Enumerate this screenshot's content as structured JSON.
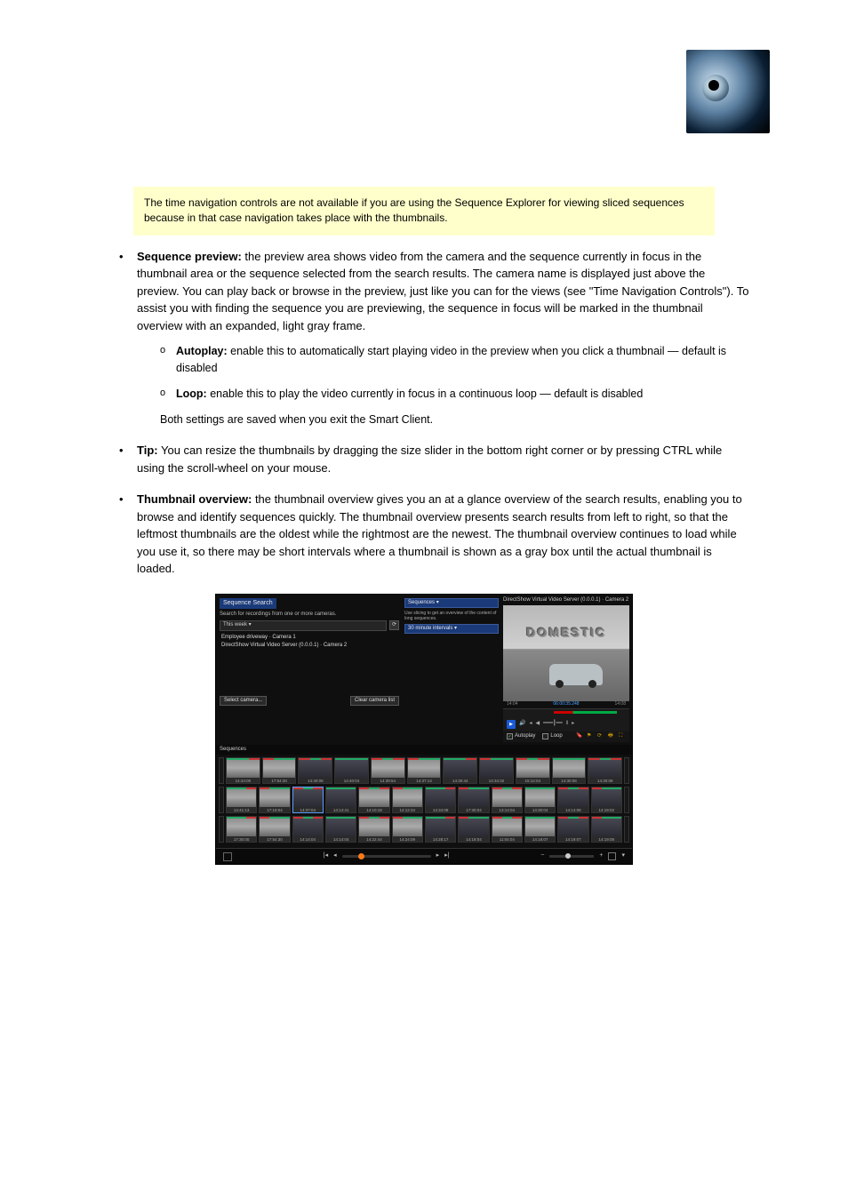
{
  "note": "The time navigation controls are not available if you are using the Sequence Explorer for viewing sliced sequences because in that case navigation takes place with the thumbnails.",
  "bullets": {
    "seq_preview": {
      "heading": "Sequence preview:",
      "text": " the preview area shows video from the camera and the sequence currently in focus in the thumbnail area or the sequence selected from the search results. The camera name is displayed just above the preview. You can play back or browse in the preview, just like you can for the views (see \"Time Navigation Controls\"). To assist you with finding the sequence you are previewing, the sequence in focus will be marked in the thumbnail overview with an expanded, light gray frame.",
      "sub": {
        "autoplay": {
          "heading": "Autoplay:",
          "text": " enable this to automatically start playing video in the preview when you click a thumbnail — default is disabled"
        },
        "loop": {
          "heading": "Loop:",
          "text": " enable this to play the video currently in focus in a continuous loop — default is disabled"
        },
        "hint": "Both settings are saved when you exit the Smart Client."
      }
    },
    "tip": {
      "label": "Tip:",
      "text": " You can resize the thumbnails by dragging the size slider in the bottom right corner or by pressing CTRL while using the scroll-wheel on your mouse."
    },
    "thumb_overview": {
      "heading": "Thumbnail overview:",
      "text": " the thumbnail overview gives you an at a glance overview of the search results, enabling you to browse and identify sequences quickly. The thumbnail overview presents search results from left to right, so that the leftmost thumbnails are the oldest while the rightmost are the newest. The thumbnail overview continues to load while you use it, so there may be short intervals where a thumbnail is shown as a gray box until the actual thumbnail is loaded."
    }
  },
  "shot": {
    "tab_title": "Sequence Search",
    "left": {
      "subtitle": "Search for recordings from one or more cameras.",
      "period_label": "This week",
      "cam1": "Employee driveway · Camera 1",
      "cam2": "DirectShow Virtual Video Server (0.0.0.1) · Camera 2",
      "select_btn": "Select camera...",
      "clear_btn": "Clear camera list"
    },
    "mid": {
      "mode": "Sequences",
      "hint": "Use slicing to get an overview of the content of long sequences.",
      "interval": "30 minute intervals"
    },
    "preview": {
      "title": "DirectShow Virtual Video Server (0.0.0.1) · Camera 2",
      "building": "DOMESTIC",
      "tl_left": "14:04",
      "tl_center": "06:00:35.248",
      "tl_right": "14:08",
      "autoplay": "Autoplay",
      "loop": "Loop"
    },
    "seq_header": "Sequences",
    "thumb_times_r1": [
      "14:44:00",
      "17:54:30",
      "14:40:08",
      "14:40:04",
      "14:39:54",
      "14:37:13",
      "14:30:44",
      "14:34:32",
      "15:12:04",
      "14:30:08",
      "14:30:08"
    ],
    "thumb_times_r2": [
      "14:41:13",
      "17:19:04",
      "14:37:04",
      "14:14:41",
      "14:10:18",
      "14:12:34",
      "14:34:08",
      "17:30:04",
      "13:14:04",
      "14:30:04",
      "14:14:08",
      "14:19:02"
    ],
    "thumb_times_r3": [
      "17:30:00",
      "17:54:30",
      "14:14:04",
      "14:14:04",
      "14:22:44",
      "14:24:09",
      "14:28:17",
      "14:18:04",
      "11:04:04",
      "14:18:07",
      "14:19:07",
      "14:19:08"
    ]
  }
}
